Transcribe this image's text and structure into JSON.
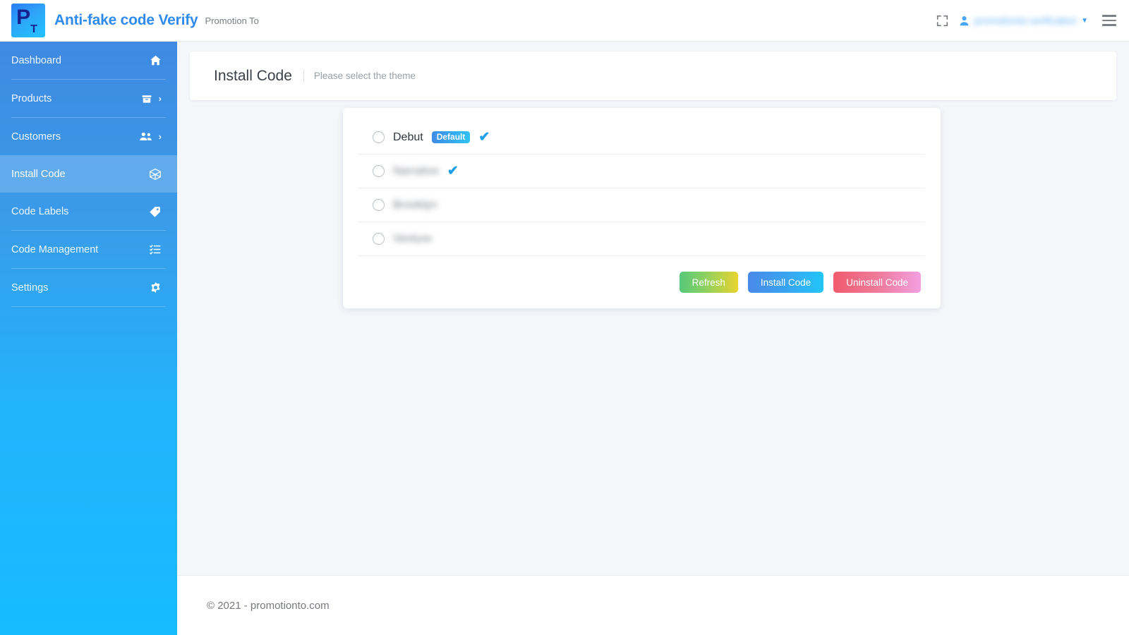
{
  "header": {
    "brand_title": "Anti-fake code Verify",
    "brand_subtitle": "Promotion To",
    "logo_letter": "P",
    "logo_sub_letter": "T",
    "user_name": "promotionto-verification",
    "fullscreen_icon": "fullscreen-icon",
    "user_icon": "user-icon",
    "caret_icon": "chevron-down-icon",
    "menu_icon": "hamburger-icon"
  },
  "sidebar": {
    "items": [
      {
        "label": "Dashboard",
        "icon": "home-icon",
        "has_arrow": false,
        "active": false
      },
      {
        "label": "Products",
        "icon": "box-icon",
        "has_arrow": true,
        "active": false
      },
      {
        "label": "Customers",
        "icon": "users-icon",
        "has_arrow": true,
        "active": false
      },
      {
        "label": "Install Code",
        "icon": "cube-icon",
        "has_arrow": false,
        "active": true
      },
      {
        "label": "Code Labels",
        "icon": "tag-icon",
        "has_arrow": false,
        "active": false
      },
      {
        "label": "Code Management",
        "icon": "list-icon",
        "has_arrow": false,
        "active": false
      },
      {
        "label": "Settings",
        "icon": "gear-icon",
        "has_arrow": false,
        "active": false
      }
    ]
  },
  "page": {
    "title": "Install Code",
    "subtitle": "Please select the theme"
  },
  "themes": [
    {
      "name": "Debut",
      "badge": "Default",
      "has_badge": true,
      "installed": true,
      "blurred": false,
      "selected": false
    },
    {
      "name": "Narrative",
      "badge": "",
      "has_badge": false,
      "installed": true,
      "blurred": true,
      "selected": false
    },
    {
      "name": "Brooklyn",
      "badge": "",
      "has_badge": false,
      "installed": false,
      "blurred": true,
      "selected": false
    },
    {
      "name": "Venture",
      "badge": "",
      "has_badge": false,
      "installed": false,
      "blurred": true,
      "selected": false
    }
  ],
  "buttons": {
    "refresh": "Refresh",
    "install": "Install Code",
    "uninstall": "Uninstall Code"
  },
  "footer": {
    "text": "© 2021 - promotionto.com"
  },
  "colors": {
    "brand_blue": "#2f8bf0",
    "sidebar_top": "#3f89e2",
    "sidebar_bottom": "#17bbff",
    "check_blue": "#1f9fe8",
    "page_bg": "#f5f6fa"
  }
}
